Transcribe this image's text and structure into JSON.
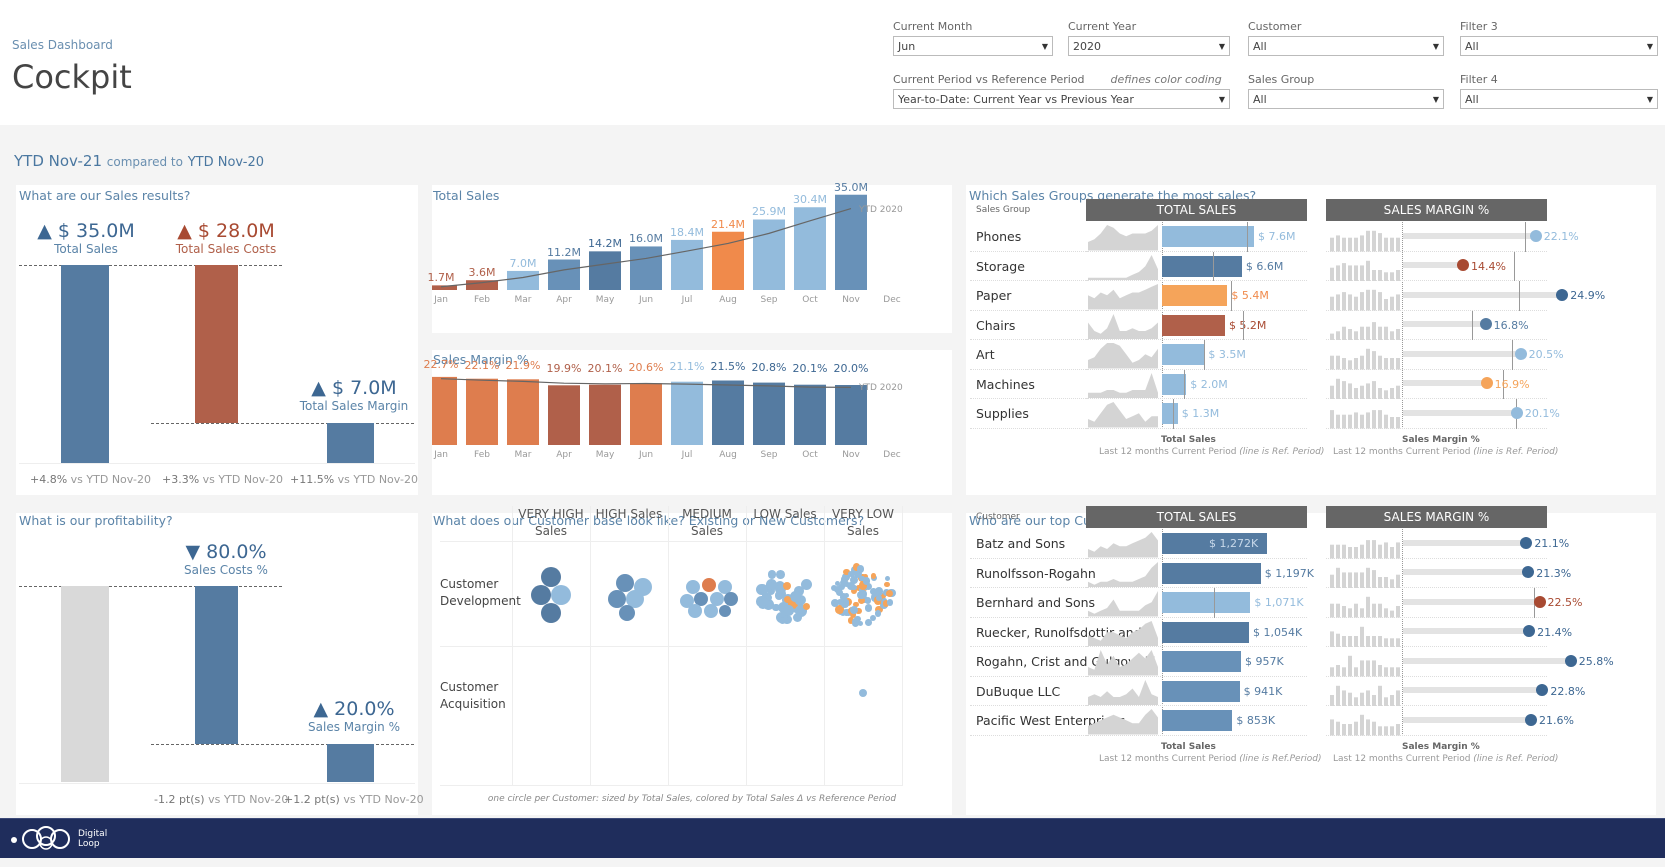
{
  "header": {
    "subtitle": "Sales Dashboard",
    "title": "Cockpit"
  },
  "filters": [
    {
      "label": "Current Month",
      "value": "Jun"
    },
    {
      "label": "Current Year",
      "value": "2020"
    },
    {
      "label": "Customer",
      "value": "All"
    },
    {
      "label": "Filter 3",
      "value": "All"
    },
    {
      "label": "Current Period vs Reference Period",
      "note": "defines color coding",
      "value": "Year-to-Date: Current Year vs Previous Year"
    },
    {
      "label": "Sales Group",
      "value": "All"
    },
    {
      "label": "Filter 4",
      "value": "All"
    }
  ],
  "period": {
    "current": "YTD Nov-21",
    "compared": "compared to",
    "reference": "YTD Nov-20"
  },
  "colors": {
    "dark_blue": "#557ba1",
    "mid_blue": "#6891b8",
    "light_blue": "#93bbdc",
    "red": "#b0604a",
    "orange": "#de7d4e",
    "light_orange": "#f5a45a",
    "grey": "#d9d9d9",
    "navy": "#1f2d5c"
  },
  "sales_results": {
    "title": "What are our Sales results?",
    "kpis": [
      {
        "arrow": "▲",
        "value": "$ 35.0M",
        "label": "Total Sales",
        "change": "+4.8%",
        "vs": "vs YTD Nov-20",
        "color": "#3d6792"
      },
      {
        "arrow": "▲",
        "value": "$ 28.0M",
        "label": "Total Sales Costs",
        "change": "+3.3%",
        "vs": "vs YTD Nov-20",
        "color": "#a84a32"
      },
      {
        "arrow": "▲",
        "value": "$ 7.0M",
        "label": "Total Sales Margin",
        "change": "+11.5%",
        "vs": "vs YTD Nov-20",
        "color": "#3d6792"
      }
    ]
  },
  "profitability": {
    "title": "What is our profitability?",
    "kpis": [
      {
        "arrow": "▼",
        "value": "80.0%",
        "label": "Sales Costs %",
        "change": "-1.2 pt(s)",
        "vs": "vs YTD Nov-20"
      },
      {
        "arrow": "▲",
        "value": "20.0%",
        "label": "Sales Margin %",
        "change": "+1.2 pt(s)",
        "vs": "vs YTD Nov-20"
      }
    ]
  },
  "chart_data": [
    {
      "type": "bar",
      "title": "Total Sales",
      "categories": [
        "Jan",
        "Feb",
        "Mar",
        "Apr",
        "May",
        "Jun",
        "Jul",
        "Aug",
        "Sep",
        "Oct",
        "Nov",
        "Dec"
      ],
      "values": [
        1.7,
        3.6,
        7.0,
        11.2,
        14.2,
        16.0,
        18.4,
        21.4,
        25.9,
        30.4,
        35.0,
        null
      ],
      "labels": [
        "1.7M",
        "3.6M",
        "7.0M",
        "11.2M",
        "14.2M",
        "16.0M",
        "18.4M",
        "21.4M",
        "25.9M",
        "30.4M",
        "35.0M",
        ""
      ],
      "bar_colors": [
        "#b0604a",
        "#b0604a",
        "#93bbdc",
        "#6891b8",
        "#557ba1",
        "#6891b8",
        "#93bbdc",
        "#f08a4b",
        "#93bbdc",
        "#93bbdc",
        "#6891b8",
        null
      ],
      "label_colors": [
        "#b0604a",
        "#b0604a",
        "#93bbdc",
        "#557ba1",
        "#3d6792",
        "#557ba1",
        "#93bbdc",
        "#f08a4b",
        "#93bbdc",
        "#93bbdc",
        "#557ba1",
        ""
      ],
      "reference_line": {
        "label": "YTD 2020",
        "values": [
          1.2,
          2.7,
          4.6,
          7.4,
          9.5,
          11.6,
          14.3,
          17.1,
          20.8,
          25.4,
          29.9
        ]
      },
      "ylim": [
        0,
        36
      ]
    },
    {
      "type": "bar",
      "title": "Sales Margin %",
      "categories": [
        "Jan",
        "Feb",
        "Mar",
        "Apr",
        "May",
        "Jun",
        "Jul",
        "Aug",
        "Sep",
        "Oct",
        "Nov",
        "Dec"
      ],
      "values": [
        22.7,
        22.1,
        21.9,
        19.9,
        20.1,
        20.6,
        21.1,
        21.5,
        20.8,
        20.1,
        20.0,
        null
      ],
      "labels": [
        "22.7%",
        "22.1%",
        "21.9%",
        "19.9%",
        "20.1%",
        "20.6%",
        "21.1%",
        "21.5%",
        "20.8%",
        "20.1%",
        "20.0%",
        ""
      ],
      "bar_colors": [
        "#de7d4e",
        "#de7d4e",
        "#de7d4e",
        "#b0604a",
        "#b0604a",
        "#de7d4e",
        "#93bbdc",
        "#557ba1",
        "#557ba1",
        "#557ba1",
        "#557ba1",
        null
      ],
      "label_colors": [
        "#de7d4e",
        "#de7d4e",
        "#de7d4e",
        "#b0604a",
        "#b0604a",
        "#de7d4e",
        "#93bbdc",
        "#3d6792",
        "#3d6792",
        "#3d6792",
        "#3d6792",
        ""
      ],
      "reference_line": {
        "label": "YTD 2020",
        "values": [
          22.1,
          21.6,
          21.2,
          20.6,
          20.4,
          20.5,
          20.3,
          20.0,
          19.7,
          19.3,
          19.2
        ]
      },
      "ylim": [
        0,
        24
      ]
    }
  ],
  "sales_groups": {
    "title": "Which Sales Groups generate the most sales?",
    "col_label": "Sales Group",
    "sales_header": "TOTAL SALES",
    "margin_header": "SALES MARGIN %",
    "footer_sales_title": "Total Sales",
    "footer_sales_sub": "Last 12 months Current Period",
    "footer_sales_note": "(line is Ref. Period)",
    "footer_margin_title": "Sales Margin %",
    "footer_margin_sub1": "Last 12 months",
    "footer_margin_sub2": "Current Period",
    "footer_margin_note": "(line is Ref. Period)",
    "max_sales": 7.6,
    "rows": [
      {
        "name": "Phones",
        "sales": 7.6,
        "sales_label": "$ 7.6M",
        "ref": 7.0,
        "color": "#93bbdc",
        "margin": 22.1,
        "margin_label": "22.1%",
        "margin_ref": 21.0,
        "dot": "#93bbdc",
        "spark": [
          3,
          4,
          6,
          9,
          8,
          6,
          5,
          6,
          6,
          6,
          7,
          9
        ],
        "mbars": [
          6,
          7,
          6,
          6,
          6,
          7,
          9,
          9,
          8,
          6,
          6,
          6
        ]
      },
      {
        "name": "Storage",
        "sales": 6.6,
        "sales_label": "$ 6.6M",
        "ref": 4.2,
        "color": "#557ba1",
        "margin": 14.4,
        "margin_label": "14.4%",
        "margin_ref": 19.8,
        "dot": "#a84a32",
        "spark": [
          1,
          1,
          1,
          1,
          1,
          1,
          1,
          2,
          3,
          5,
          9,
          4
        ],
        "mbars": [
          6,
          7,
          8,
          7,
          7,
          7,
          9,
          5,
          5,
          4,
          4,
          5
        ]
      },
      {
        "name": "Paper",
        "sales": 5.4,
        "sales_label": "$ 5.4M",
        "ref": 5.7,
        "color": "#f5a45a",
        "margin": 24.9,
        "margin_label": "24.9%",
        "margin_ref": 20.3,
        "dot": "#3d6792",
        "spark": [
          5,
          4,
          6,
          5,
          7,
          4,
          5,
          6,
          6,
          7,
          8,
          9
        ],
        "mbars": [
          6,
          7,
          8,
          7,
          6,
          8,
          9,
          9,
          8,
          5,
          6,
          7
        ]
      },
      {
        "name": "Chairs",
        "sales": 5.2,
        "sales_label": "$ 5.2M",
        "ref": 6.7,
        "color": "#b0604a",
        "margin": 16.8,
        "margin_label": "16.8%",
        "margin_ref": 15.3,
        "dot": "#557ba1",
        "spark": [
          6,
          3,
          2,
          4,
          9,
          3,
          3,
          4,
          3,
          3,
          4,
          6
        ],
        "mbars": [
          3,
          4,
          6,
          5,
          4,
          6,
          6,
          8,
          6,
          6,
          4,
          5
        ]
      },
      {
        "name": "Art",
        "sales": 3.5,
        "sales_label": "$ 3.5M",
        "ref": 3.5,
        "color": "#93bbdc",
        "margin": 20.5,
        "margin_label": "20.5%",
        "margin_ref": 19.6,
        "dot": "#93bbdc",
        "spark": [
          3,
          4,
          7,
          9,
          9,
          8,
          5,
          2,
          3,
          5,
          4,
          7
        ],
        "mbars": [
          6,
          6,
          5,
          4,
          5,
          6,
          9,
          8,
          6,
          5,
          5,
          5
        ]
      },
      {
        "name": "Machines",
        "sales": 2.0,
        "sales_label": "$ 2.0M",
        "ref": 1.8,
        "color": "#93bbdc",
        "margin": 16.9,
        "margin_label": "16.9%",
        "margin_ref": 18.6,
        "dot": "#f5a45a",
        "spark": [
          2,
          2,
          2,
          3,
          3,
          2,
          2,
          3,
          3,
          3,
          9,
          2
        ],
        "mbars": [
          6,
          9,
          8,
          7,
          5,
          6,
          7,
          8,
          5,
          4,
          5,
          6
        ]
      },
      {
        "name": "Supplies",
        "sales": 1.3,
        "sales_label": "$ 1.3M",
        "ref": 0.9,
        "color": "#93bbdc",
        "margin": 20.1,
        "margin_label": "20.1%",
        "margin_ref": 20.0,
        "dot": "#93bbdc",
        "spark": [
          3,
          2,
          5,
          8,
          9,
          6,
          3,
          4,
          5,
          2,
          4,
          4
        ],
        "mbars": [
          8,
          6,
          6,
          6,
          7,
          6,
          7,
          8,
          8,
          6,
          5,
          5
        ]
      }
    ]
  },
  "customer_base": {
    "title": "What does our Customer base look like? Existing or New Customers?",
    "columns": [
      {
        "line1": "VERY HIGH",
        "line2": "Sales"
      },
      {
        "line1": "HIGH Sales",
        "line2": ""
      },
      {
        "line1": "MEDIUM",
        "line2": "Sales"
      },
      {
        "line1": "LOW Sales",
        "line2": ""
      },
      {
        "line1": "VERY LOW",
        "line2": "Sales"
      }
    ],
    "rows": [
      {
        "line1": "Customer",
        "line2": "Development"
      },
      {
        "line1": "Customer",
        "line2": "Acquisition"
      }
    ],
    "caption": "one circle per Customer: sized by Total Sales, colored by Total Sales Δ vs Reference Period"
  },
  "top_customers": {
    "title": "Who are our top Customers?",
    "col_label": "Customer",
    "sales_header": "TOTAL SALES",
    "margin_header": "SALES MARGIN %",
    "footer_sales_title": "Total Sales",
    "footer_sales_sub": "Last 12 months Current Period",
    "footer_sales_note": "(line is Ref.Period)",
    "footer_margin_title": "Sales Margin %",
    "footer_margin_sub1": "Last 12 months",
    "footer_margin_sub2": "Current Period",
    "footer_margin_note": "(line is Ref. Period)",
    "max_sales": 1272,
    "rows": [
      {
        "name": "Batz and Sons",
        "sales": 1272,
        "sales_label": "$ 1,272K",
        "label_inside": true,
        "ref": null,
        "color": "#557ba1",
        "margin": 21.1,
        "margin_label": "21.1%",
        "margin_ref": null,
        "dot": "#3d6792",
        "spark": [
          3,
          2,
          4,
          3,
          5,
          4,
          4,
          5,
          6,
          7,
          9,
          6
        ],
        "mbars": [
          6,
          6,
          6,
          5,
          5,
          6,
          8,
          8,
          6,
          7,
          5,
          7
        ]
      },
      {
        "name": "Runolfsson-Rogahn",
        "sales": 1197,
        "sales_label": "$ 1,197K",
        "label_inside": false,
        "ref": null,
        "color": "#557ba1",
        "margin": 21.3,
        "margin_label": "21.3%",
        "margin_ref": null,
        "dot": "#3d6792",
        "spark": [
          2,
          1,
          2,
          2,
          3,
          2,
          2,
          2,
          3,
          4,
          7,
          9
        ],
        "mbars": [
          6,
          9,
          7,
          7,
          7,
          7,
          9,
          8,
          5,
          5,
          4,
          6
        ]
      },
      {
        "name": "Bernhard and Sons",
        "sales": 1071,
        "sales_label": "$ 1,071K",
        "label_inside": false,
        "ref": 630,
        "color": "#93bbdc",
        "margin": 22.5,
        "margin_label": "22.5%",
        "margin_ref": 21.9,
        "dot": "#a84a32",
        "spark": [
          2,
          1,
          2,
          3,
          6,
          2,
          2,
          2,
          2,
          4,
          5,
          9
        ],
        "mbars": [
          6,
          6,
          5,
          4,
          6,
          4,
          9,
          6,
          6,
          4,
          3,
          5
        ]
      },
      {
        "name": "Ruecker, Runolfsdottir and ..",
        "sales": 1054,
        "sales_label": "$ 1,054K",
        "label_inside": false,
        "ref": null,
        "color": "#557ba1",
        "margin": 21.4,
        "margin_label": "21.4%",
        "margin_ref": null,
        "dot": "#3d6792",
        "spark": [
          4,
          3,
          2,
          5,
          5,
          4,
          3,
          5,
          6,
          8,
          9,
          3
        ],
        "mbars": [
          7,
          6,
          5,
          5,
          5,
          9,
          5,
          5,
          5,
          4,
          4,
          4
        ]
      },
      {
        "name": "Rogahn, Crist and Gulgowski",
        "sales": 957,
        "sales_label": "$ 957K",
        "label_inside": false,
        "ref": null,
        "color": "#6891b8",
        "margin": 25.8,
        "margin_label": "25.8%",
        "margin_ref": null,
        "dot": "#3d6792",
        "spark": [
          3,
          2,
          9,
          4,
          7,
          3,
          4,
          6,
          8,
          6,
          9,
          3
        ],
        "mbars": [
          4,
          5,
          4,
          9,
          4,
          7,
          7,
          7,
          5,
          4,
          4,
          4
        ]
      },
      {
        "name": "DuBuque LLC",
        "sales": 941,
        "sales_label": "$ 941K",
        "label_inside": false,
        "ref": null,
        "color": "#6891b8",
        "margin": 22.8,
        "margin_label": "22.8%",
        "margin_ref": null,
        "dot": "#3d6792",
        "spark": [
          3,
          4,
          3,
          5,
          3,
          3,
          4,
          6,
          3,
          9,
          4,
          3
        ],
        "mbars": [
          5,
          9,
          7,
          6,
          4,
          6,
          7,
          5,
          9,
          4,
          5,
          7
        ]
      },
      {
        "name": "Pacific West Enterprises",
        "sales": 853,
        "sales_label": "$ 853K",
        "label_inside": false,
        "ref": null,
        "color": "#6891b8",
        "margin": 21.6,
        "margin_label": "21.6%",
        "margin_ref": null,
        "dot": "#3d6792",
        "spark": [
          3,
          4,
          5,
          6,
          7,
          6,
          5,
          4,
          4,
          7,
          9,
          6
        ],
        "mbars": [
          7,
          6,
          5,
          5,
          6,
          9,
          7,
          6,
          4,
          4,
          4,
          5
        ]
      }
    ]
  },
  "footer": {
    "logo_line1": "Digital",
    "logo_line2": "Loop"
  }
}
